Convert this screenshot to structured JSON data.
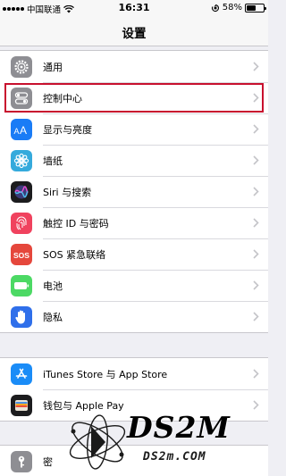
{
  "status_bar": {
    "carrier": "中国联通",
    "time": "16:31",
    "battery_text": "58%",
    "battery_level": 0.58
  },
  "nav": {
    "title": "设置"
  },
  "groups": [
    {
      "rows": [
        {
          "label": "通用",
          "icon": "gear-icon",
          "color": "#8e8e93"
        },
        {
          "label": "控制中心",
          "icon": "toggle-icon",
          "color": "#8e8e93",
          "highlighted": true
        },
        {
          "label": "显示与亮度",
          "icon": "text-size-icon",
          "color": "#1a7cf6"
        },
        {
          "label": "墙纸",
          "icon": "flower-icon",
          "color": "#35aadc"
        },
        {
          "label": "Siri 与搜索",
          "icon": "siri-icon",
          "color": "#1c1c1e"
        },
        {
          "label": "触控 ID 与密码",
          "icon": "fingerprint-icon",
          "color": "#f0425e"
        },
        {
          "label": "SOS 紧急联络",
          "icon": "sos-icon",
          "color": "#e5473c"
        },
        {
          "label": "电池",
          "icon": "battery-icon",
          "color": "#4cd964"
        },
        {
          "label": "隐私",
          "icon": "hand-icon",
          "color": "#2f6fea"
        }
      ]
    },
    {
      "rows": [
        {
          "label": "iTunes Store 与 App Store",
          "icon": "app-store-icon",
          "color": "#1a8cf7"
        },
        {
          "label": "钱包与 Apple Pay",
          "icon": "wallet-icon",
          "color": "#1c1c1e"
        }
      ]
    },
    {
      "rows": [
        {
          "label": "密",
          "icon": "key-icon",
          "color": "#8e8e93"
        }
      ]
    }
  ],
  "watermark": {
    "main": "DS2M",
    "sub": "DS2m.COM"
  },
  "colors": {
    "highlight": "#c8102e",
    "background": "#efeff4"
  }
}
